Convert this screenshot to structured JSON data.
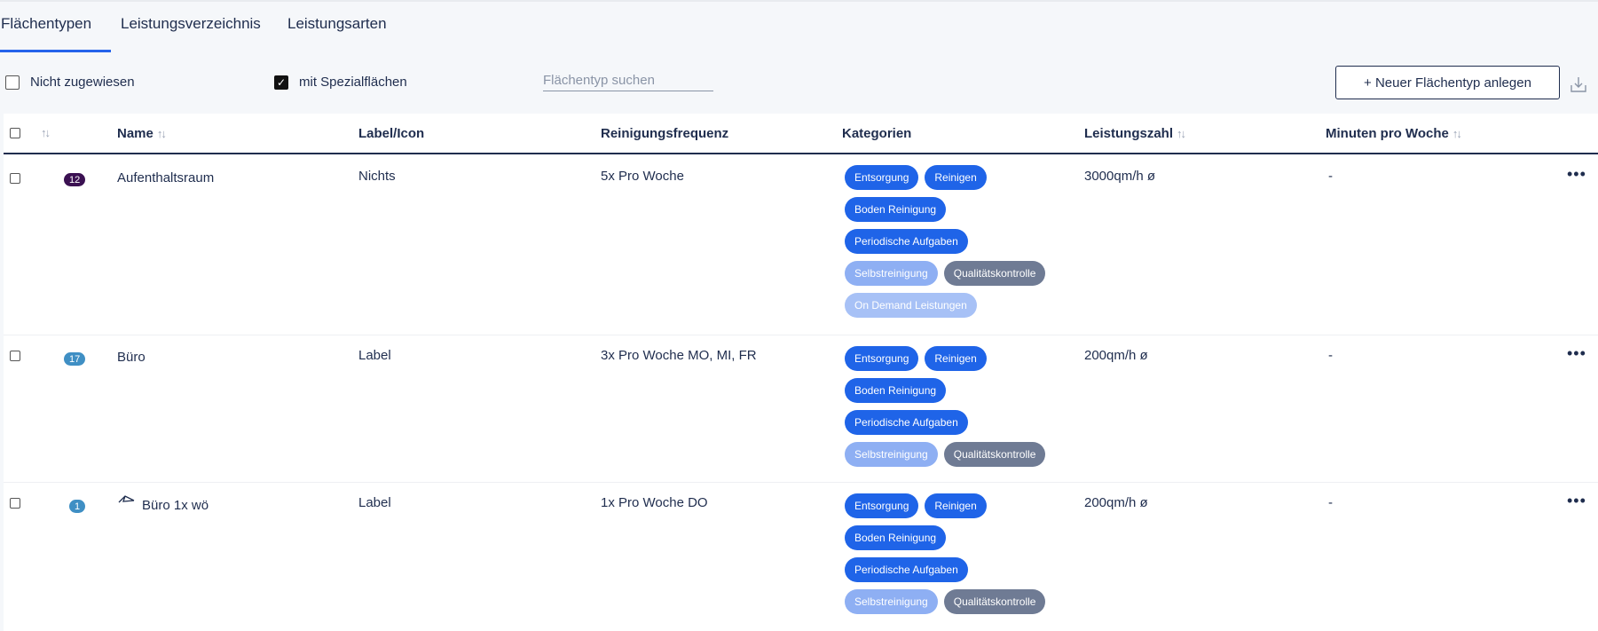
{
  "tabs": [
    {
      "label": "Flächentypen",
      "active": true
    },
    {
      "label": "Leistungsverzeichnis",
      "active": false
    },
    {
      "label": "Leistungsarten",
      "active": false
    }
  ],
  "toolbar": {
    "unassigned_label": "Nicht zugewiesen",
    "unassigned_checked": false,
    "special_label": "mit Spezialflächen",
    "special_checked": true,
    "search_placeholder": "Flächentyp suchen",
    "new_button_label": "+ Neuer Flächentyp anlegen"
  },
  "table": {
    "headers": {
      "name": "Name",
      "label_icon": "Label/Icon",
      "frequency": "Reinigungsfrequenz",
      "categories": "Kategorien",
      "performance": "Leistungszahl",
      "minutes": "Minuten pro Woche"
    },
    "rows": [
      {
        "count": "12",
        "count_color": "#3b1152",
        "name": "Aufenthaltsraum",
        "label_icon": "Nichts",
        "frequency": "5x Pro Woche",
        "performance": "3000qm/h ø",
        "minutes": "-",
        "categories": [
          "Entsorgung",
          "Reinigen",
          "Boden Reinigung",
          "Periodische Aufgaben",
          "Selbstreinigung",
          "Qualitätskontrolle",
          "On Demand Leistungen"
        ]
      },
      {
        "count": "17",
        "count_color": "#3f8fc4",
        "name": "Büro",
        "label_icon": "Label",
        "frequency": "3x Pro Woche MO, MI, FR",
        "performance": "200qm/h ø",
        "minutes": "-",
        "categories": [
          "Entsorgung",
          "Reinigen",
          "Boden Reinigung",
          "Periodische Aufgaben",
          "Selbstreinigung",
          "Qualitätskontrolle"
        ]
      },
      {
        "count": "1",
        "count_color": "#3f8fc4",
        "name": "Büro 1x wö",
        "label_icon": "Label",
        "frequency": "1x Pro Woche DO",
        "performance": "200qm/h ø",
        "minutes": "-",
        "categories": [
          "Entsorgung",
          "Reinigen",
          "Boden Reinigung",
          "Periodische Aufgaben",
          "Selbstreinigung",
          "Qualitätskontrolle"
        ]
      }
    ],
    "more_label": "•••"
  }
}
